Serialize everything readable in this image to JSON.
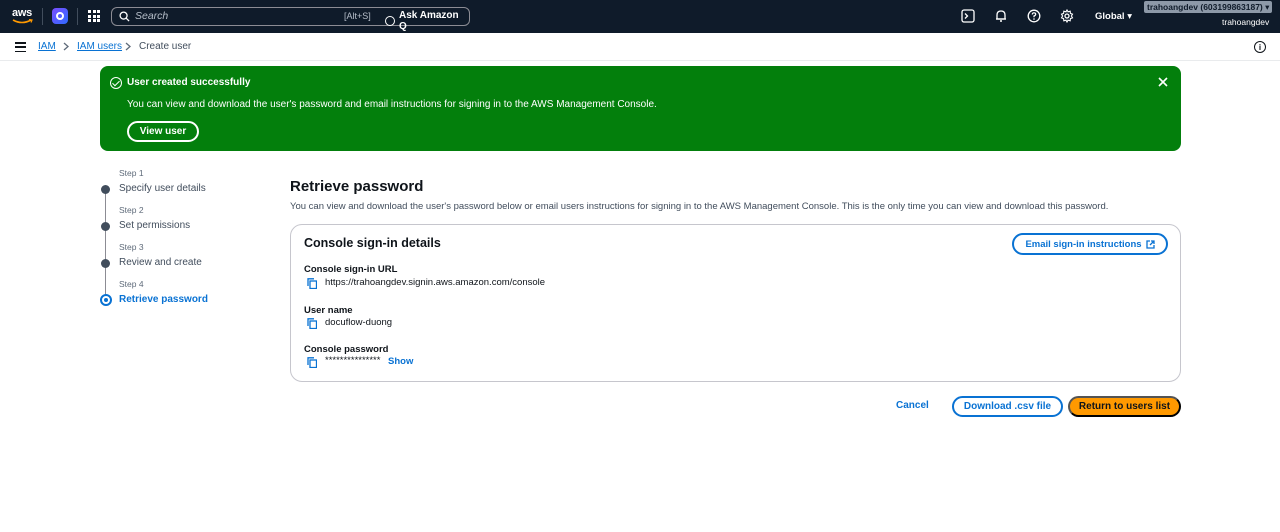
{
  "topnav": {
    "logo_text": "aws",
    "search_placeholder": "Search",
    "search_shortcut": "[Alt+S]",
    "ask_q": "Ask Amazon Q",
    "region": "Global ▾",
    "account": "trahoangdev (603199863187) ▾",
    "user": "trahoangdev"
  },
  "breadcrumb": {
    "items": [
      "IAM",
      "IAM users",
      "Create user"
    ]
  },
  "flash": {
    "title": "User created successfully",
    "message": "You can view and download the user's password and email instructions for signing in to the AWS Management Console.",
    "button": "View user"
  },
  "steps": [
    {
      "num": "Step 1",
      "label": "Specify user details"
    },
    {
      "num": "Step 2",
      "label": "Set permissions"
    },
    {
      "num": "Step 3",
      "label": "Review and create"
    },
    {
      "num": "Step 4",
      "label": "Retrieve password"
    }
  ],
  "main": {
    "title": "Retrieve password",
    "description": "You can view and download the user's password below or email users instructions for signing in to the AWS Management Console. This is the only time you can view and download this password.",
    "card": {
      "title": "Console sign-in details",
      "email_button": "Email sign-in instructions",
      "url_label": "Console sign-in URL",
      "url_value": "https://trahoangdev.signin.aws.amazon.com/console",
      "username_label": "User name",
      "username_value": "docuflow-duong",
      "password_label": "Console password",
      "password_value": "***************",
      "show": "Show"
    }
  },
  "actions": {
    "cancel": "Cancel",
    "download": "Download .csv file",
    "return": "Return to users list"
  },
  "colors": {
    "nav_bg": "#0f1b2a",
    "success": "#037f0c",
    "link": "#0972d3",
    "primary": "#ff9900"
  }
}
